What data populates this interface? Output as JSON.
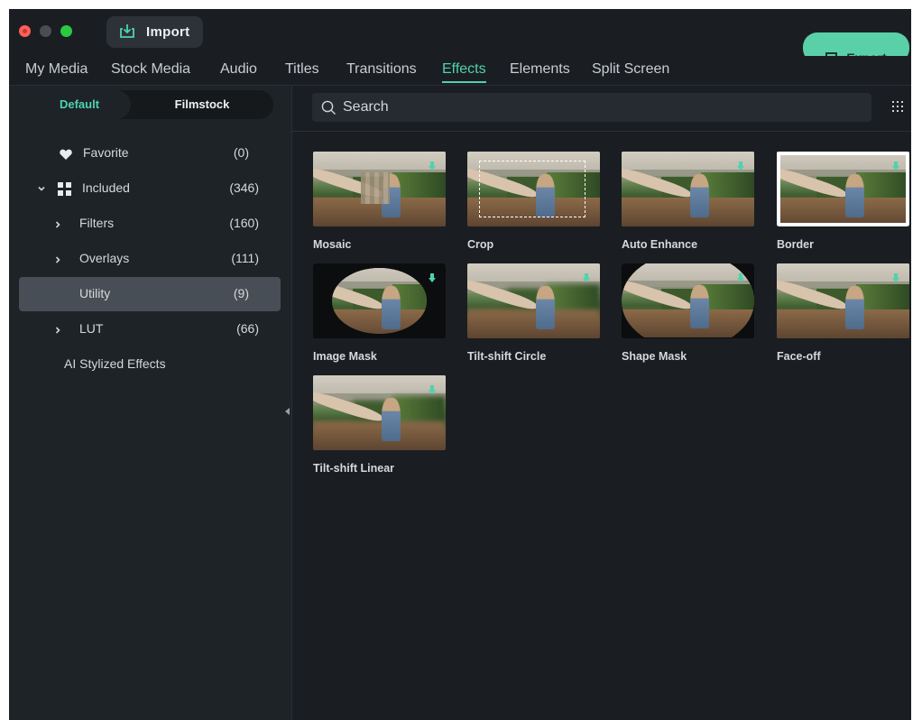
{
  "window": {
    "import_label": "Import",
    "export_label": "Export"
  },
  "tabs": [
    {
      "label": "My Media",
      "active": false
    },
    {
      "label": "Stock Media",
      "active": false
    },
    {
      "label": "Audio",
      "active": false
    },
    {
      "label": "Titles",
      "active": false
    },
    {
      "label": "Transitions",
      "active": false
    },
    {
      "label": "Effects",
      "active": true
    },
    {
      "label": "Elements",
      "active": false
    },
    {
      "label": "Split Screen",
      "active": false
    }
  ],
  "sidebar": {
    "segment": {
      "default": "Default",
      "filmstock": "Filmstock",
      "selected": "Default"
    },
    "items": [
      {
        "label": "Favorite",
        "count": "(0)",
        "icon": "heart-icon"
      },
      {
        "label": "Included",
        "count": "(346)",
        "icon": "grid-icon",
        "expanded": true
      },
      {
        "label": "Filters",
        "count": "(160)"
      },
      {
        "label": "Overlays",
        "count": "(111)"
      },
      {
        "label": "Utility",
        "count": "(9)",
        "selected": true
      },
      {
        "label": "LUT",
        "count": "(66)"
      },
      {
        "label": "AI Stylized Effects",
        "count": ""
      }
    ]
  },
  "search": {
    "placeholder": "Search"
  },
  "effects": [
    {
      "name": "Mosaic",
      "variant": "mosaic"
    },
    {
      "name": "Crop",
      "variant": "crop"
    },
    {
      "name": "Auto Enhance",
      "variant": "plain"
    },
    {
      "name": "Border",
      "variant": "border",
      "selected": true
    },
    {
      "name": "Image Mask",
      "variant": "image-mask"
    },
    {
      "name": "Tilt-shift Circle",
      "variant": "blur"
    },
    {
      "name": "Shape Mask",
      "variant": "shape-mask"
    },
    {
      "name": "Face-off",
      "variant": "plain"
    },
    {
      "name": "Tilt-shift Linear",
      "variant": "blur"
    }
  ],
  "colors": {
    "accent": "#4fd2ad",
    "background": "#1a1e22",
    "sidebar": "#1e2328",
    "selected_item": "#484e55",
    "export_button": "#5ad0a8"
  }
}
